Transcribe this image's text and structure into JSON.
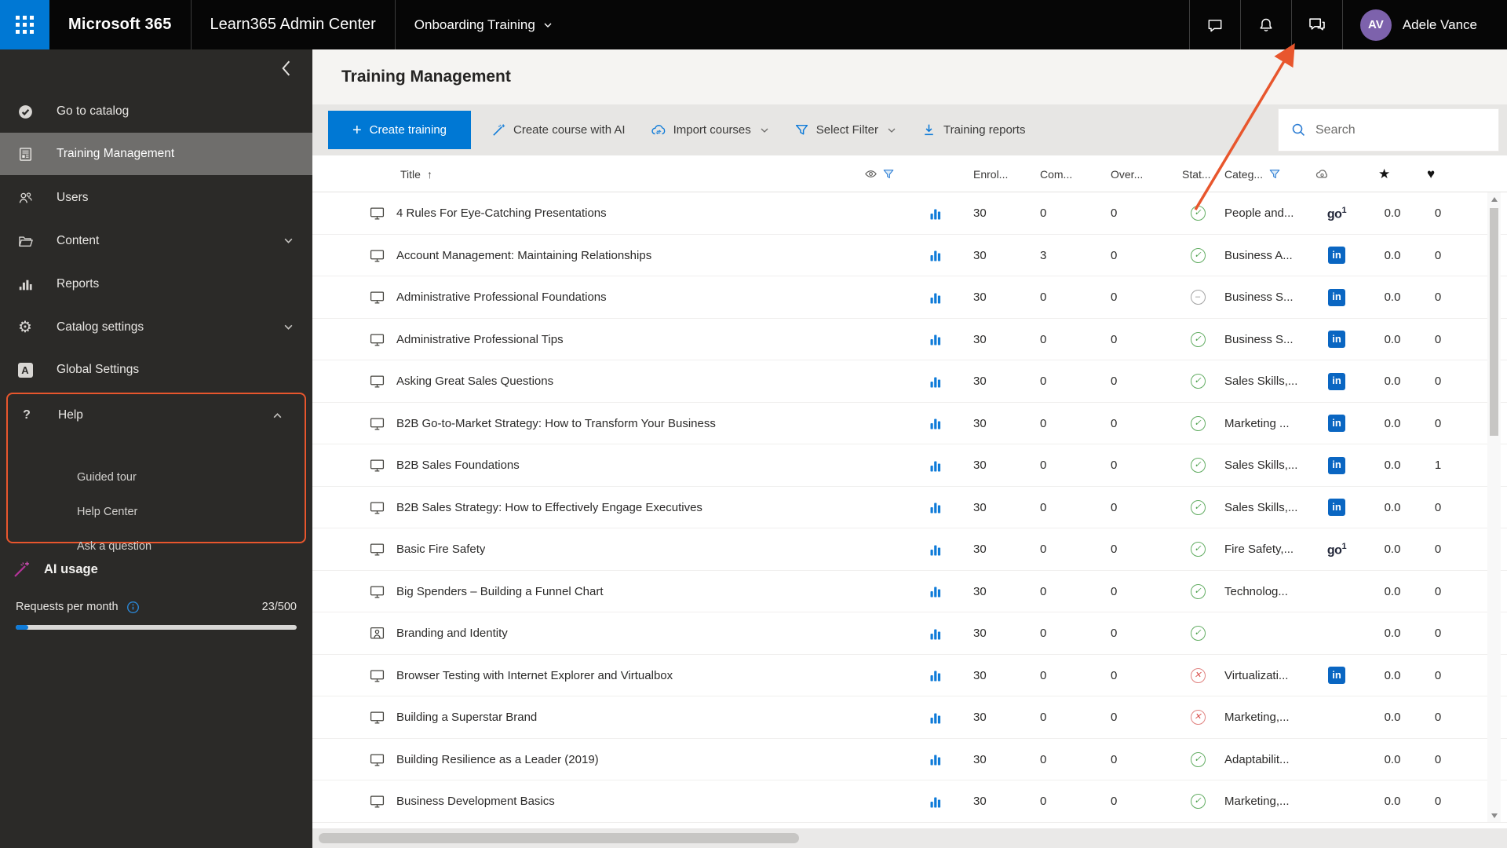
{
  "colors": {
    "accent_blue": "#0078d4",
    "highlight_orange": "#e8562d",
    "linkedin_blue": "#0a66c2",
    "status_green": "#4ea24e",
    "status_gray": "#8d8d8d",
    "status_red": "#d9534f",
    "avatar_purple": "#7d62ac",
    "ai_wand_pink": "#b5339a"
  },
  "topbar": {
    "brand": "Microsoft 365",
    "app_title": "Learn365 Admin Center",
    "context_switcher": "Onboarding Training",
    "user_name": "Adele Vance",
    "avatar_initials": "AV"
  },
  "sidebar": {
    "items": [
      {
        "label": "Go to catalog",
        "icon": "circle-check"
      },
      {
        "label": "Training Management",
        "icon": "document-list",
        "selected": true
      },
      {
        "label": "Users",
        "icon": "people"
      },
      {
        "label": "Content",
        "icon": "folder",
        "chevron": "down"
      },
      {
        "label": "Reports",
        "icon": "bar-chart"
      },
      {
        "label": "Catalog settings",
        "icon": "gear",
        "chevron": "down"
      },
      {
        "label": "Global Settings",
        "icon": "admin-logo"
      },
      {
        "label": "Help",
        "icon": "question-mark",
        "chevron": "up",
        "highlighted": true,
        "children": [
          "Guided tour",
          "Help Center",
          "Ask a question"
        ]
      }
    ],
    "gear_glyph": "⚙",
    "question_glyph": "?",
    "admin_glyph": "A",
    "ai_usage": {
      "title": "AI usage",
      "requests_label": "Requests per month",
      "requests_value": "23/500",
      "progress_fraction": 0.046
    }
  },
  "page": {
    "title": "Training Management"
  },
  "toolbar": {
    "create_training": "Create training",
    "create_training_plus": "+",
    "create_course_ai": "Create course with AI",
    "import_courses": "Import courses",
    "select_filter": "Select Filter",
    "training_reports": "Training reports",
    "search_placeholder": "Search"
  },
  "table": {
    "columns": {
      "title": "Title",
      "sort_glyph": "↑",
      "enrolled": "Enrol...",
      "completed": "Com...",
      "overdue": "Over...",
      "status": "Stat...",
      "category": "Categ...",
      "star_glyph": "★",
      "heart_glyph": "♥"
    },
    "status_glyphs": {
      "published": "✓",
      "inactive": "–",
      "unpublished": "✕"
    },
    "provider_glyphs": {
      "linkedin": "in",
      "go1_base": "go",
      "go1_sup": "1"
    },
    "rows": [
      {
        "title": "4 Rules For Eye-Catching Presentations",
        "type": "e-learning",
        "enrolled": "30",
        "completed": "0",
        "overdue": "0",
        "status": "published",
        "category": "People and...",
        "provider": "go1",
        "rating": "0.0",
        "likes": "0"
      },
      {
        "title": "Account Management: Maintaining Relationships",
        "type": "e-learning",
        "enrolled": "30",
        "completed": "3",
        "overdue": "0",
        "status": "published",
        "category": "Business A...",
        "provider": "linkedin",
        "rating": "0.0",
        "likes": "0"
      },
      {
        "title": "Administrative Professional Foundations",
        "type": "e-learning",
        "enrolled": "30",
        "completed": "0",
        "overdue": "0",
        "status": "inactive",
        "category": "Business S...",
        "provider": "linkedin",
        "rating": "0.0",
        "likes": "0"
      },
      {
        "title": "Administrative Professional Tips",
        "type": "e-learning",
        "enrolled": "30",
        "completed": "0",
        "overdue": "0",
        "status": "published",
        "category": "Business S...",
        "provider": "linkedin",
        "rating": "0.0",
        "likes": "0"
      },
      {
        "title": "Asking Great Sales Questions",
        "type": "e-learning",
        "enrolled": "30",
        "completed": "0",
        "overdue": "0",
        "status": "published",
        "category": "Sales Skills,...",
        "provider": "linkedin",
        "rating": "0.0",
        "likes": "0"
      },
      {
        "title": "B2B Go-to-Market Strategy: How to Transform Your Business",
        "type": "e-learning",
        "enrolled": "30",
        "completed": "0",
        "overdue": "0",
        "status": "published",
        "category": "Marketing ...",
        "provider": "linkedin",
        "rating": "0.0",
        "likes": "0"
      },
      {
        "title": "B2B Sales Foundations",
        "type": "e-learning",
        "enrolled": "30",
        "completed": "0",
        "overdue": "0",
        "status": "published",
        "category": "Sales Skills,...",
        "provider": "linkedin",
        "rating": "0.0",
        "likes": "1"
      },
      {
        "title": "B2B Sales Strategy: How to Effectively Engage Executives",
        "type": "e-learning",
        "enrolled": "30",
        "completed": "0",
        "overdue": "0",
        "status": "published",
        "category": "Sales Skills,...",
        "provider": "linkedin",
        "rating": "0.0",
        "likes": "0"
      },
      {
        "title": "Basic Fire Safety",
        "type": "e-learning",
        "enrolled": "30",
        "completed": "0",
        "overdue": "0",
        "status": "published",
        "category": "Fire Safety,...",
        "provider": "go1",
        "rating": "0.0",
        "likes": "0"
      },
      {
        "title": "Big Spenders – Building a Funnel Chart",
        "type": "e-learning",
        "enrolled": "30",
        "completed": "0",
        "overdue": "0",
        "status": "published",
        "category": "Technolog...",
        "provider": "",
        "rating": "0.0",
        "likes": "0"
      },
      {
        "title": "Branding and Identity",
        "type": "classroom",
        "enrolled": "30",
        "completed": "0",
        "overdue": "0",
        "status": "published",
        "category": "",
        "provider": "",
        "rating": "0.0",
        "likes": "0"
      },
      {
        "title": "Browser Testing with Internet Explorer and Virtualbox",
        "type": "e-learning",
        "enrolled": "30",
        "completed": "0",
        "overdue": "0",
        "status": "unpublished",
        "category": "Virtualizati...",
        "provider": "linkedin",
        "rating": "0.0",
        "likes": "0"
      },
      {
        "title": "Building a Superstar Brand",
        "type": "e-learning",
        "enrolled": "30",
        "completed": "0",
        "overdue": "0",
        "status": "unpublished",
        "category": "Marketing,...",
        "provider": "",
        "rating": "0.0",
        "likes": "0"
      },
      {
        "title": "Building Resilience as a Leader (2019)",
        "type": "e-learning",
        "enrolled": "30",
        "completed": "0",
        "overdue": "0",
        "status": "published",
        "category": "Adaptabilit...",
        "provider": "",
        "rating": "0.0",
        "likes": "0"
      },
      {
        "title": "Business Development Basics",
        "type": "e-learning",
        "enrolled": "30",
        "completed": "0",
        "overdue": "0",
        "status": "published",
        "category": "Marketing,...",
        "provider": "",
        "rating": "0.0",
        "likes": "0"
      }
    ]
  }
}
